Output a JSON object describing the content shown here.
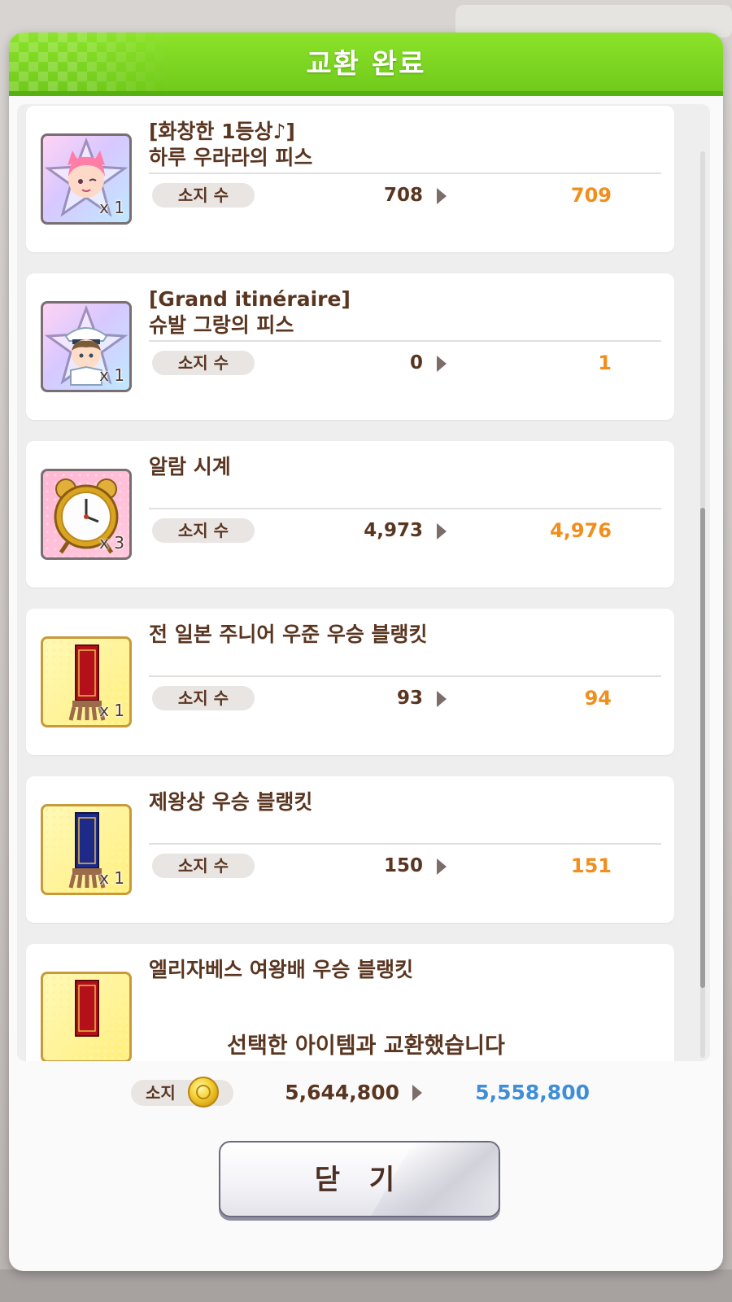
{
  "header": {
    "title": "교환 완료"
  },
  "items": [
    {
      "name_line1": "[화창한 1등상♪]",
      "name_line2": "하루 우라라의 피스",
      "qty": "x 1",
      "owned_label": "소지 수",
      "before": "708",
      "after": "709",
      "icon": "haru-urara-piece-icon"
    },
    {
      "name_line1": "[Grand itinéraire]",
      "name_line2": "슈발 그랑의 피스",
      "qty": "x 1",
      "owned_label": "소지 수",
      "before": "0",
      "after": "1",
      "icon": "cheval-grand-piece-icon"
    },
    {
      "name_line1": "알람 시계",
      "name_line2": "",
      "qty": "x 3",
      "owned_label": "소지 수",
      "before": "4,973",
      "after": "4,976",
      "icon": "alarm-clock-icon"
    },
    {
      "name_line1": "전 일본 주니어 우준 우승 블랭킷",
      "name_line2": "",
      "qty": "x 1",
      "owned_label": "소지 수",
      "before": "93",
      "after": "94",
      "icon": "red-blanket-icon"
    },
    {
      "name_line1": "제왕상 우승 블랭킷",
      "name_line2": "",
      "qty": "x 1",
      "owned_label": "소지 수",
      "before": "150",
      "after": "151",
      "icon": "blue-blanket-icon"
    },
    {
      "name_line1": "엘리자베스 여왕배 우승 블랭킷",
      "name_line2": "",
      "qty": "",
      "owned_label": "",
      "before": "",
      "after": "",
      "icon": "red-blanket-icon"
    }
  ],
  "footer": {
    "message": "선택한 아이템과 교환했습니다",
    "owned_label": "소지",
    "currency_icon": "gold-coin-icon",
    "money_before": "5,644,800",
    "money_after": "5,558,800",
    "close_label": "닫 기"
  },
  "colors": {
    "header_green": "#7ed321",
    "new_value_orange": "#f18e1c",
    "money_after_blue": "#3f8ed6",
    "text_brown": "#5a3621"
  }
}
